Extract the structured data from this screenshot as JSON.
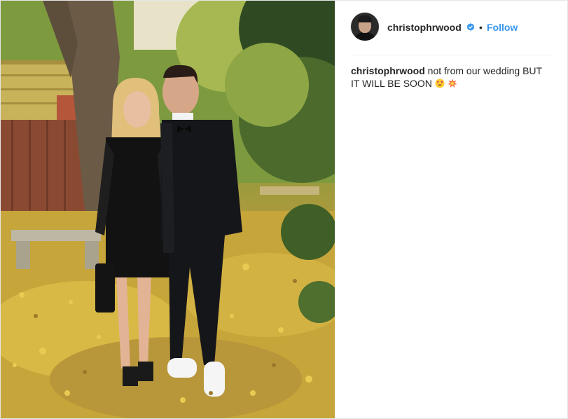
{
  "post": {
    "username": "christophrwood",
    "follow_label": "Follow",
    "separator": "•",
    "caption": {
      "username": "christophrwood",
      "text": "not from our wedding BUT IT WILL BE SOON"
    }
  },
  "icons": {
    "verified": "verified-badge-icon",
    "emoji_1": "heart-eyes-emoji",
    "emoji_2": "collision-emoji"
  },
  "colors": {
    "link": "#3897f0",
    "text": "#262626",
    "border": "#efefef"
  }
}
